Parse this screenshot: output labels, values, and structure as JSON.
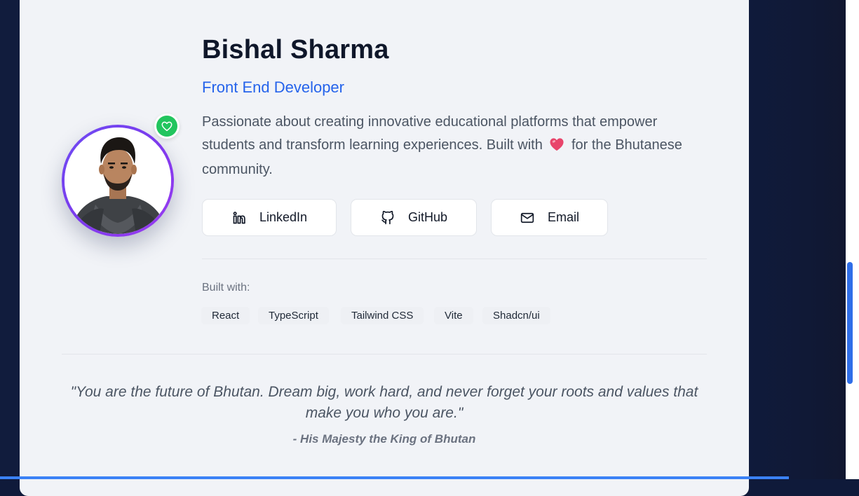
{
  "profile": {
    "name": "Bishal Sharma",
    "role": "Front End Developer",
    "bio_part1": "Passionate about creating innovative educational platforms that empower students and transform learning experiences. Built with",
    "bio_part2": "for the Bhutanese community."
  },
  "social": {
    "linkedin_label": "LinkedIn",
    "github_label": "GitHub",
    "email_label": "Email"
  },
  "built_with": {
    "label": "Built with:",
    "tags": [
      "React",
      "TypeScript",
      "Tailwind CSS",
      "Vite",
      "Shadcn/ui"
    ]
  },
  "quote": {
    "text": "\"You are the future of Bhutan. Dream big, work hard, and never forget your roots and values that make you who you are.\"",
    "author": "- His Majesty the King of Bhutan"
  },
  "icons": {
    "status_badge": "heart-icon",
    "bio_heart": "heart-emoji",
    "linkedin": "linkedin-icon",
    "github": "github-icon",
    "email": "mail-icon"
  },
  "colors": {
    "accent": "#2563eb",
    "badge": "#22c55e",
    "avatar_ring": "#7c3aed",
    "page_bg": "#0f1a3a",
    "card_bg": "#f1f3f7"
  }
}
